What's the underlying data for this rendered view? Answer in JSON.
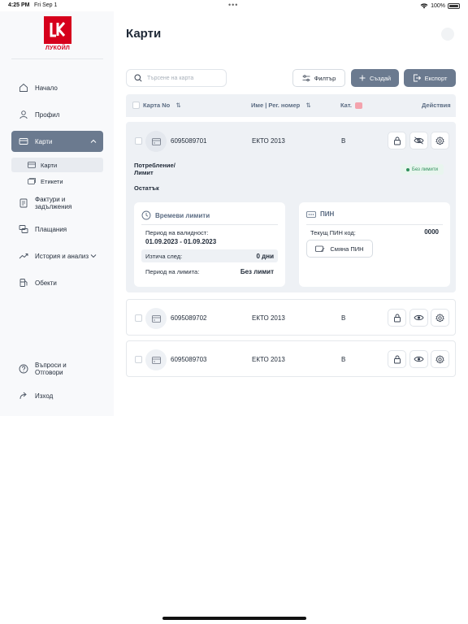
{
  "status_bar": {
    "time": "4:25 PM",
    "date": "Fri Sep 1",
    "battery": "100%"
  },
  "brand": {
    "logo_text": "ЛУКОЙЛ"
  },
  "sidebar": {
    "home": "Начало",
    "profile": "Профил",
    "cards": "Карти",
    "cards_sub": "Карти",
    "labels_sub": "Етикети",
    "invoices": "Фактури и задължения",
    "payments": "Плащания",
    "history": "История и анализ",
    "objects": "Обекти",
    "faq": "Въпроси и Отговори",
    "logout": "Изход"
  },
  "page": {
    "title": "Карти"
  },
  "toolbar": {
    "search_placeholder": "Търсене на карта",
    "filter_label": "Филтър",
    "create_label": "Създай",
    "export_label": "Експорт"
  },
  "table": {
    "headers": {
      "card_no": "Карта No",
      "name": "Име | Рег. номер",
      "category": "Кат.",
      "actions": "Действия"
    },
    "rows": [
      {
        "card_no": "6095089701",
        "name": "ЕКТО 2013",
        "category": "B"
      },
      {
        "card_no": "6095089702",
        "name": "ЕКТО 2013",
        "category": "B"
      },
      {
        "card_no": "6095089703",
        "name": "ЕКТО 2013",
        "category": "B"
      }
    ]
  },
  "details": {
    "consumption_label": "Потребление/ Лимит",
    "remaining_label": "Остатък",
    "no_limits_badge": "Без лимити",
    "time_limits": {
      "title": "Времеви лимити",
      "validity_label": "Период на валидност:",
      "validity_value": "01.09.2023 - 01.09.2023",
      "expires_label": "Изтича след:",
      "expires_value": "0 дни",
      "period_label": "Период на лимита:",
      "period_value": "Без лимит"
    },
    "pin": {
      "title": "ПИН",
      "current_label": "Текущ ПИН код:",
      "current_value": "0000",
      "change_button": "Смяна ПИН"
    }
  },
  "colors": {
    "accent": "#6b7a8f",
    "brand_red": "#d6001c",
    "success": "#2f8f5b"
  }
}
